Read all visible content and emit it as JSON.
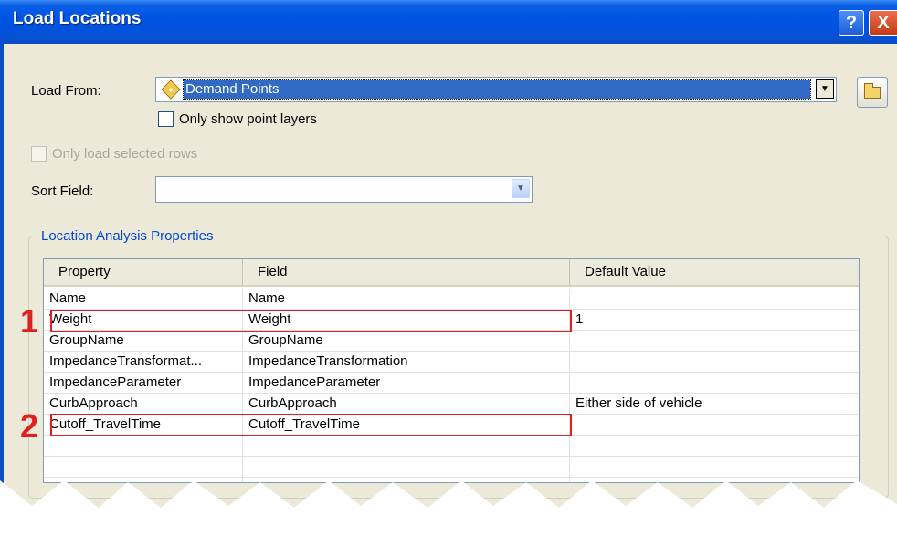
{
  "window": {
    "title": "Load Locations",
    "help_glyph": "?",
    "close_glyph": "X"
  },
  "load_from": {
    "label": "Load From:",
    "value": "Demand Points",
    "arrow": "▼"
  },
  "only_show_point_layers": {
    "label": "Only show point layers",
    "checked": false
  },
  "only_load_selected_rows": {
    "label": "Only load selected rows",
    "checked": false,
    "enabled": false
  },
  "sort_field": {
    "label": "Sort Field:",
    "value": "",
    "arrow": "▼"
  },
  "properties_group": {
    "title": "Location Analysis Properties",
    "columns": [
      "Property",
      "Field",
      "Default Value"
    ],
    "rows": [
      {
        "property": "Name",
        "field": "Name",
        "default": ""
      },
      {
        "property": "Weight",
        "field": "Weight",
        "default": "1"
      },
      {
        "property": "GroupName",
        "field": "GroupName",
        "default": ""
      },
      {
        "property": "ImpedanceTransformat...",
        "field": "ImpedanceTransformation",
        "default": ""
      },
      {
        "property": "ImpedanceParameter",
        "field": "ImpedanceParameter",
        "default": ""
      },
      {
        "property": "CurbApproach",
        "field": "CurbApproach",
        "default": "Either side of vehicle"
      },
      {
        "property": "Cutoff_TravelTime",
        "field": "Cutoff_TravelTime",
        "default": ""
      }
    ]
  },
  "annotations": {
    "marker_1": "1",
    "marker_2": "2",
    "highlight_color": "#e02020"
  },
  "colors": {
    "title_bar": "#0054e3",
    "dialog_bg": "#ece9d8",
    "selection": "#316ac5",
    "group_title": "#0046d5"
  }
}
